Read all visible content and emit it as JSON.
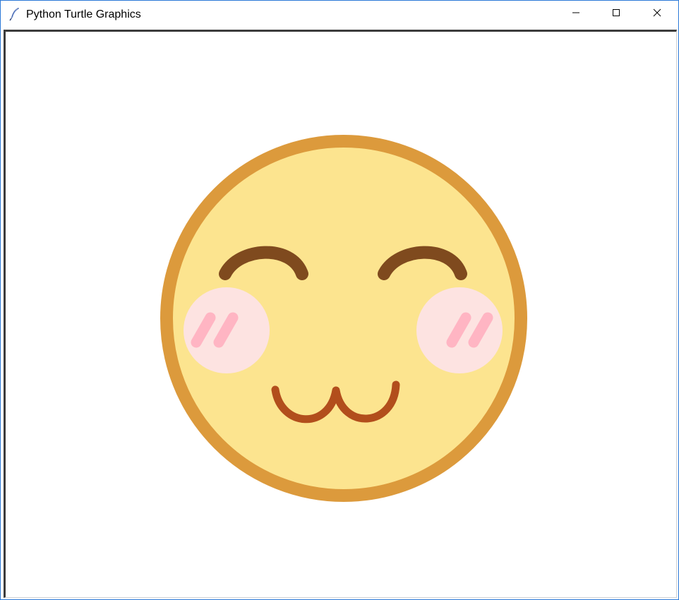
{
  "window": {
    "title": "Python Turtle Graphics",
    "controls": {
      "minimize": "minimize-icon",
      "maximize": "maximize-icon",
      "close": "close-icon"
    }
  },
  "colors": {
    "face_fill": "#fce48f",
    "face_outline": "#dc9a3c",
    "eyebrow": "#7f4a1e",
    "blush_fill": "#fde3e1",
    "blush_stroke": "#ffb5c3",
    "mouth": "#b24e1c"
  }
}
